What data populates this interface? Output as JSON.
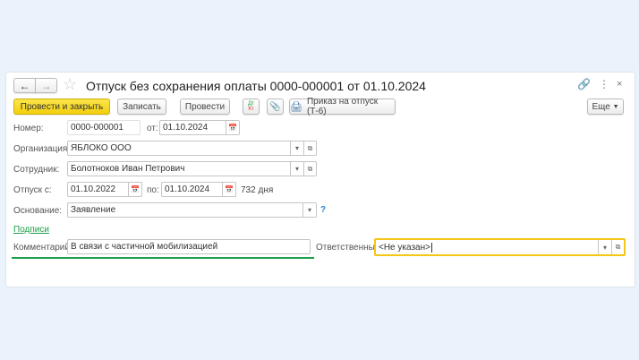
{
  "title": "Отпуск без сохранения оплаты 0000-000001 от 01.10.2024",
  "toolbar": {
    "post_close": "Провести и закрыть",
    "save": "Записать",
    "post": "Провести",
    "dtkt_top": "Дт",
    "dtkt_bottom": "Кт",
    "print": "Приказ на отпуск (Т-6)",
    "more": "Еще"
  },
  "form": {
    "number_label": "Номер:",
    "number": "0000-000001",
    "from_label": "от:",
    "date": "01.10.2024",
    "org_label": "Организация:",
    "org": "ЯБЛОКО ООО",
    "emp_label": "Сотрудник:",
    "emp": "Болотноков Иван Петрович",
    "leave_label": "Отпуск с:",
    "leave_from": "01.10.2022",
    "to_label": "по:",
    "leave_to": "01.10.2024",
    "days": "732 дня",
    "basis_label": "Основание:",
    "basis": "Заявление",
    "help": "?",
    "signatures": "Подписи",
    "comment_label": "Комментарий:",
    "comment": "В связи с частичной мобилизацией",
    "resp_label": "Ответственный:",
    "resp": "<Не указан>"
  },
  "colors": {
    "accent": "#f2cf0c",
    "link": "#1ba04a",
    "focus": "#f5c518",
    "background": "#eaf3fb"
  }
}
